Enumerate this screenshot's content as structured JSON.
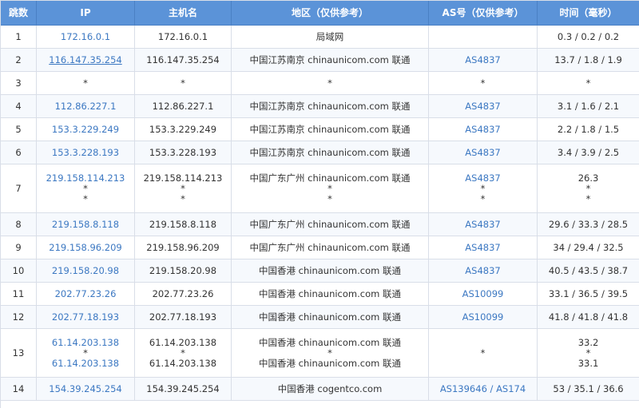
{
  "headers": [
    "跳数",
    "IP",
    "主机名",
    "地区（仅供参考）",
    "AS号（仅供参考）",
    "时间（毫秒）"
  ],
  "rows": [
    {
      "hop": "1",
      "ip": [
        "172.16.0.1"
      ],
      "host": [
        "172.16.0.1"
      ],
      "region": [
        "局域网"
      ],
      "as": [],
      "time": [
        "0.3 / 0.2 / 0.2"
      ]
    },
    {
      "hop": "2",
      "ip": [
        "116.147.35.254"
      ],
      "host": [
        "116.147.35.254"
      ],
      "region": [
        "中国江苏南京 chinaunicom.com 联通"
      ],
      "as": [
        "AS4837"
      ],
      "time": [
        "13.7 / 1.8 / 1.9"
      ],
      "ip_underline": true
    },
    {
      "hop": "3",
      "ip": [
        "*"
      ],
      "host": [
        "*"
      ],
      "region": [
        "*"
      ],
      "as": [
        "*"
      ],
      "time": [
        "*"
      ]
    },
    {
      "hop": "4",
      "ip": [
        "112.86.227.1"
      ],
      "host": [
        "112.86.227.1"
      ],
      "region": [
        "中国江苏南京 chinaunicom.com 联通"
      ],
      "as": [
        "AS4837"
      ],
      "time": [
        "3.1 / 1.6 / 2.1"
      ]
    },
    {
      "hop": "5",
      "ip": [
        "153.3.229.249"
      ],
      "host": [
        "153.3.229.249"
      ],
      "region": [
        "中国江苏南京 chinaunicom.com 联通"
      ],
      "as": [
        "AS4837"
      ],
      "time": [
        "2.2 / 1.8 / 1.5"
      ]
    },
    {
      "hop": "6",
      "ip": [
        "153.3.228.193"
      ],
      "host": [
        "153.3.228.193"
      ],
      "region": [
        "中国江苏南京 chinaunicom.com 联通"
      ],
      "as": [
        "AS4837"
      ],
      "time": [
        "3.4 / 3.9 / 2.5"
      ]
    },
    {
      "hop": "7",
      "ip": [
        "219.158.114.213",
        "*",
        "*"
      ],
      "host": [
        "219.158.114.213",
        "*",
        "*"
      ],
      "region": [
        "中国广东广州 chinaunicom.com 联通",
        "*",
        "*"
      ],
      "as": [
        "AS4837",
        "*",
        "*"
      ],
      "time": [
        "26.3",
        "*",
        "*"
      ]
    },
    {
      "hop": "8",
      "ip": [
        "219.158.8.118"
      ],
      "host": [
        "219.158.8.118"
      ],
      "region": [
        "中国广东广州 chinaunicom.com 联通"
      ],
      "as": [
        "AS4837"
      ],
      "time": [
        "29.6 / 33.3 / 28.5"
      ]
    },
    {
      "hop": "9",
      "ip": [
        "219.158.96.209"
      ],
      "host": [
        "219.158.96.209"
      ],
      "region": [
        "中国广东广州 chinaunicom.com 联通"
      ],
      "as": [
        "AS4837"
      ],
      "time": [
        "34 / 29.4 / 32.5"
      ]
    },
    {
      "hop": "10",
      "ip": [
        "219.158.20.98"
      ],
      "host": [
        "219.158.20.98"
      ],
      "region": [
        "中国香港 chinaunicom.com 联通"
      ],
      "as": [
        "AS4837"
      ],
      "time": [
        "40.5 / 43.5 / 38.7"
      ]
    },
    {
      "hop": "11",
      "ip": [
        "202.77.23.26"
      ],
      "host": [
        "202.77.23.26"
      ],
      "region": [
        "中国香港 chinaunicom.com 联通"
      ],
      "as": [
        "AS10099"
      ],
      "time": [
        "33.1 / 36.5 / 39.5"
      ]
    },
    {
      "hop": "12",
      "ip": [
        "202.77.18.193"
      ],
      "host": [
        "202.77.18.193"
      ],
      "region": [
        "中国香港 chinaunicom.com 联通"
      ],
      "as": [
        "AS10099"
      ],
      "time": [
        "41.8 / 41.8 / 41.8"
      ]
    },
    {
      "hop": "13",
      "ip": [
        "61.14.203.138",
        "*",
        "61.14.203.138"
      ],
      "host": [
        "61.14.203.138",
        "*",
        "61.14.203.138"
      ],
      "region": [
        "中国香港 chinaunicom.com 联通",
        "*",
        "中国香港 chinaunicom.com 联通"
      ],
      "as": [
        "",
        "*",
        ""
      ],
      "time": [
        "33.2",
        "*",
        "33.1"
      ]
    },
    {
      "hop": "14",
      "ip": [
        "154.39.245.254"
      ],
      "host": [
        "154.39.245.254"
      ],
      "region": [
        "中国香港 cogentco.com"
      ],
      "as": [
        "AS139646 / AS174"
      ],
      "time": [
        "53 / 35.1 / 36.6"
      ]
    }
  ],
  "colors": {
    "header_bg": "#5b93d8",
    "link": "#3c78c2",
    "border": "#d9dee8"
  }
}
